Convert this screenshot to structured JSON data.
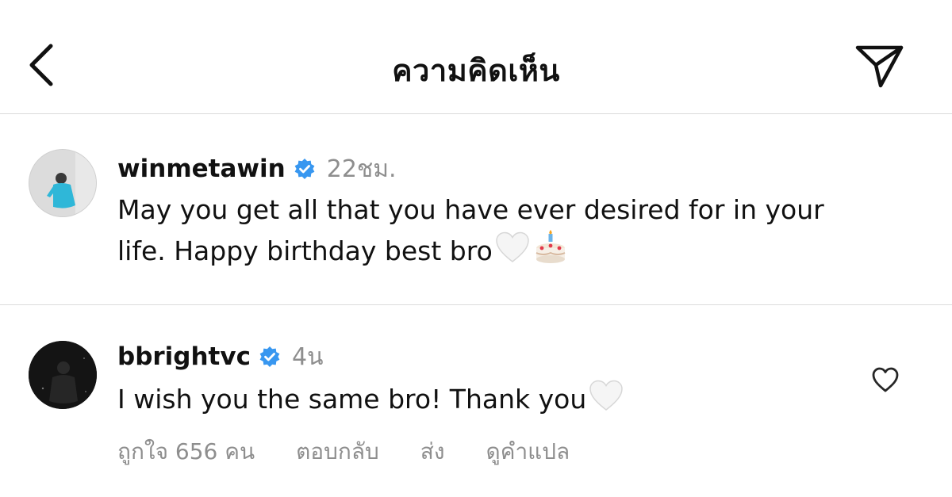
{
  "header": {
    "title": "ความคิดเห็น",
    "back_icon": "chevron-left-icon",
    "send_icon": "paper-plane-icon"
  },
  "comments": [
    {
      "username": "winmetawin",
      "verified": true,
      "time": "22ชม.",
      "text_line1": "May you get all that you have ever desired for in your",
      "text_line2": "life. Happy birthday best bro",
      "emojis": [
        "white-heart-icon",
        "birthday-cake-icon"
      ]
    },
    {
      "username": "bbrightvc",
      "verified": true,
      "time": "4น",
      "text_line1": "I wish you the same bro! Thank you",
      "emojis": [
        "white-heart-icon"
      ],
      "likes": "ถูกใจ 656 คน",
      "reply": "ตอบกลับ",
      "send": "ส่ง",
      "translate": "ดูคำแปล",
      "like_icon": "heart-outline-icon"
    }
  ],
  "colors": {
    "verified_blue": "#3897f0",
    "muted_text": "#8e8e8e",
    "divider": "#dbdbdb"
  }
}
